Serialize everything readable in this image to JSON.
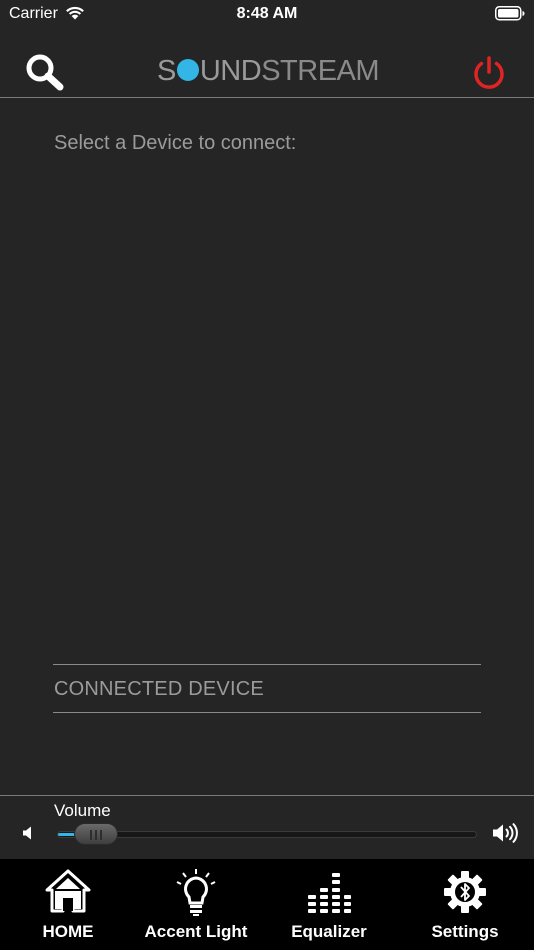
{
  "status_bar": {
    "carrier": "Carrier",
    "time": "8:48 AM"
  },
  "nav_bar": {
    "logo_prefix": "S",
    "logo_strong_rest": "UND",
    "logo_light": "STREAM",
    "icons": {
      "search": "search-icon",
      "power": "power-icon"
    },
    "power_color": "#e02424"
  },
  "main": {
    "prompt": "Select a Device to connect:",
    "connected_label": "CONNECTED DEVICE"
  },
  "volume": {
    "label": "Volume",
    "level": 0.03
  },
  "tabs": [
    {
      "label": "HOME",
      "icon": "home-icon"
    },
    {
      "label": "Accent Light",
      "icon": "lightbulb-icon"
    },
    {
      "label": "Equalizer",
      "icon": "equalizer-icon"
    },
    {
      "label": "Settings",
      "icon": "bluetooth-settings-icon"
    }
  ],
  "colors": {
    "accent": "#33b5e5",
    "background": "#252525",
    "tab_bar": "#000000"
  }
}
